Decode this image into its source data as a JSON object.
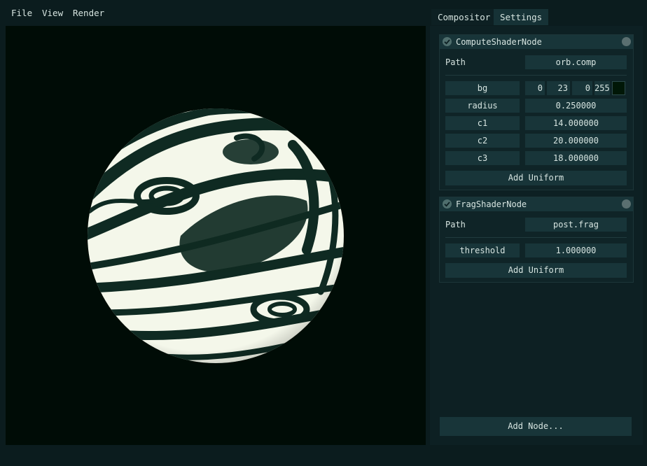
{
  "menu": {
    "file": "File",
    "view": "View",
    "render": "Render"
  },
  "tabs": {
    "compositor": "Compositor",
    "settings": "Settings"
  },
  "nodes": {
    "compute": {
      "title": "ComputeShaderNode",
      "path_label": "Path",
      "path_value": "orb.comp",
      "bg": {
        "name": "bg",
        "r": "0",
        "g": "23",
        "b": "0",
        "a": "255",
        "color": "#001707"
      },
      "uniforms": [
        {
          "name": "radius",
          "value": "0.250000"
        },
        {
          "name": "c1",
          "value": "14.000000"
        },
        {
          "name": "c2",
          "value": "20.000000"
        },
        {
          "name": "c3",
          "value": "18.000000"
        }
      ],
      "add_uniform": "Add Uniform"
    },
    "frag": {
      "title": "FragShaderNode",
      "path_label": "Path",
      "path_value": "post.frag",
      "uniforms": [
        {
          "name": "threshold",
          "value": "1.000000"
        }
      ],
      "add_uniform": "Add Uniform"
    }
  },
  "add_node": "Add Node...",
  "colors": {
    "viewport_bg": "#000c06",
    "orb_dark": "#0f2a22",
    "orb_light": "#f4f7ea",
    "panel_bg": "#0d2023",
    "field_bg": "#183539"
  }
}
